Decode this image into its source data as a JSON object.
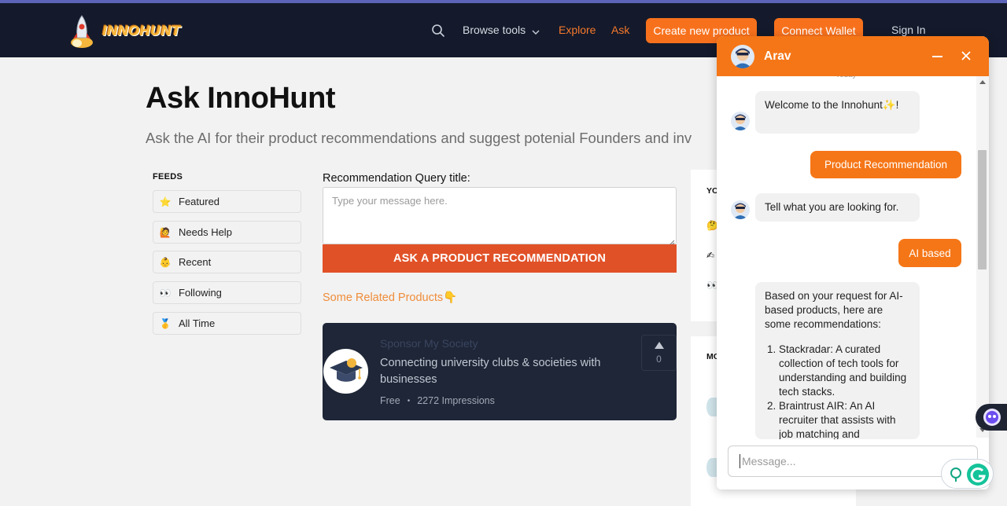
{
  "nav": {
    "logo_text": "INNOHUNT",
    "browse_label": "Browse tools",
    "explore_label": "Explore",
    "ask_label": "Ask",
    "create_label": "Create new product",
    "wallet_label": "Connect Wallet",
    "signin_label": "Sign In"
  },
  "page": {
    "title": "Ask InnoHunt",
    "subtitle": "Ask the AI for their product recommendations and suggest potenial Founders and inv"
  },
  "feeds": {
    "title": "FEEDS",
    "items": [
      {
        "emoji": "⭐",
        "label": "Featured"
      },
      {
        "emoji": "🙋",
        "label": "Needs Help"
      },
      {
        "emoji": "👶",
        "label": "Recent"
      },
      {
        "emoji": "👀",
        "label": "Following"
      },
      {
        "emoji": "🥇",
        "label": "All Time"
      }
    ]
  },
  "query": {
    "label": "Recommendation Query title:",
    "placeholder": "Type your message here.",
    "button_label": "ASK A PRODUCT RECOMMENDATION",
    "related_label": "Some Related Products👇"
  },
  "sponsor": {
    "name": "Sponsor My Society",
    "description": "Connecting university clubs & societies with businesses",
    "price": "Free",
    "impressions": "2272 Impressions",
    "votes": "0"
  },
  "right_panel": {
    "heading1": "YO",
    "emojis": [
      "🤔",
      "✍",
      "👀"
    ],
    "heading2": "MO"
  },
  "chat": {
    "agent_name": "Arav",
    "today_label": "Today",
    "messages": {
      "welcome": "Welcome to the Innohunt✨!",
      "product_rec": "Product Recommendation",
      "tell": "Tell what you are looking for.",
      "ai_based": "AI based",
      "based_intro": "Based on your request for AI-based products, here are some recommendations:",
      "rec1": "Stackradar: A curated collection of tech tools for understanding and building tech stacks.",
      "rec2": "Braintrust AIR: An AI recruiter that assists with job matching and"
    },
    "input_placeholder": "Message..."
  },
  "colors": {
    "accent": "#f57617",
    "navbar": "#141a2b",
    "ask_button": "#e15127",
    "card_bg": "#1e2637"
  }
}
